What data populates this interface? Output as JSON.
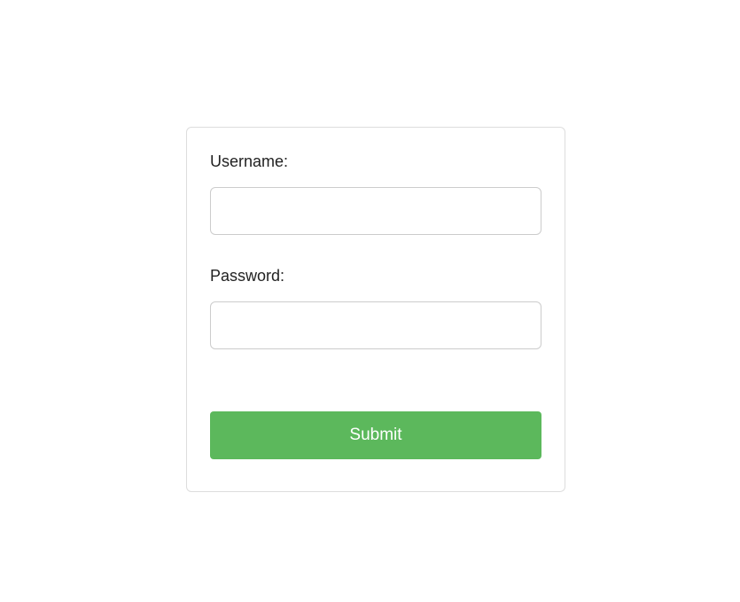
{
  "form": {
    "username_label": "Username:",
    "username_value": "",
    "password_label": "Password:",
    "password_value": "",
    "submit_label": "Submit"
  }
}
